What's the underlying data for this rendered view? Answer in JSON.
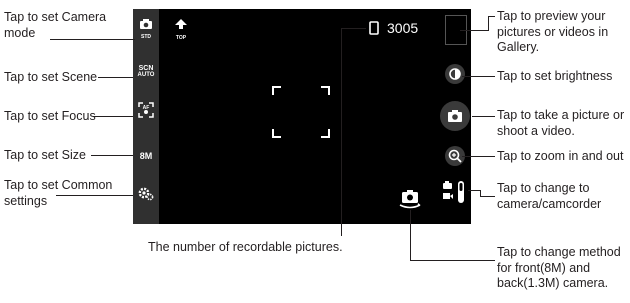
{
  "callouts": {
    "camera_mode": "Tap to set Camera\nmode",
    "scene": "Tap to set Scene",
    "focus": "Tap to set Focus",
    "size": "Tap to set Size",
    "common": "Tap to set Common\nsettings",
    "preview": "Tap to preview your\npictures or videos in\nGallery.",
    "brightness": "Tap to set brightness",
    "shutter": "Tap to take a picture or\nshoot a video.",
    "zoom": "Tap to zoom in and out",
    "switch": "Tap to change to\ncamera/camcorder",
    "recordable": "The number of recordable pictures.",
    "front_back": "Tap to change method\nfor front(8M) and\nback(1.3M) camera."
  },
  "screen": {
    "counter": "3005",
    "top_label": "TOP",
    "scene_label_top": "SCN",
    "scene_label_bottom": "AUTO",
    "focus_label": "AF",
    "size_label": "8M",
    "camera_mode_sub": "STD"
  },
  "colors": {
    "screen_bg": "#000000",
    "sidebar_bg": "#303030",
    "leader_line": "#231f20",
    "text": "#231f20"
  },
  "icons": {
    "camera_mode": "camera-icon",
    "scene": "scene-icon",
    "focus": "focus-icon",
    "size": "size-icon",
    "settings": "gear-icon",
    "top": "arrow-up-icon",
    "storage": "sd-card-icon",
    "brightness": "brightness-icon",
    "shutter": "camera-shutter-icon",
    "zoom": "zoom-icon",
    "switch": "camera-camcorder-toggle-icon",
    "front_back": "switch-camera-icon"
  }
}
